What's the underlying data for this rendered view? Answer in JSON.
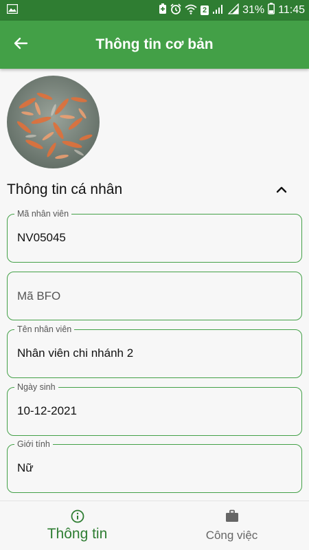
{
  "status_bar": {
    "battery_percent": "31%",
    "time": "11:45",
    "notification_count": "2",
    "icons": [
      "image-icon",
      "battery-saver-icon",
      "alarm-icon",
      "wifi-icon",
      "signal-icon",
      "battery-icon"
    ]
  },
  "app_bar": {
    "title": "Thông tin cơ bản",
    "back_icon": "arrow-left-icon"
  },
  "profile": {
    "avatar": "fish-photo"
  },
  "section": {
    "title": "Thông tin cá nhân",
    "toggle_icon": "chevron-up-icon",
    "fields": [
      {
        "label": "Mã nhân viên",
        "value": "NV05045"
      },
      {
        "placeholder": "Mã BFO"
      },
      {
        "label": "Tên nhân viên",
        "value": "Nhân viên chi nhánh 2"
      },
      {
        "label": "Ngày sinh",
        "value": "10-12-2021"
      },
      {
        "label": "Giới tính",
        "value": "Nữ"
      }
    ]
  },
  "bottom_nav": {
    "items": [
      {
        "label": "Thông tin",
        "icon": "info-icon",
        "active": true
      },
      {
        "label": "Công việc",
        "icon": "briefcase-icon",
        "active": false
      }
    ]
  },
  "colors": {
    "primary": "#43a047",
    "primary_dark": "#2f7d32",
    "active_nav": "#2e7d32"
  }
}
